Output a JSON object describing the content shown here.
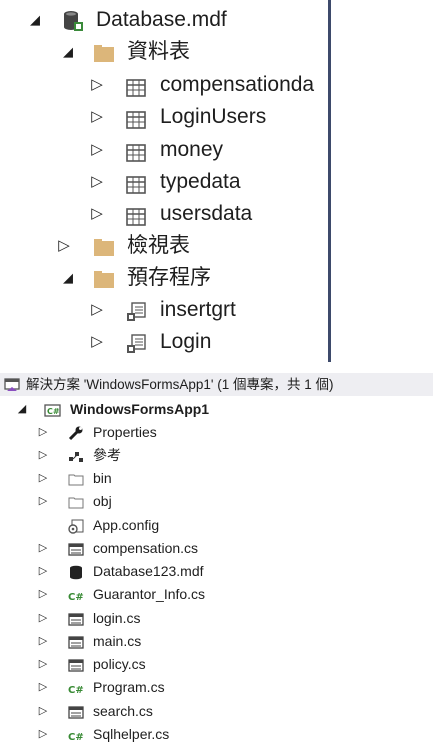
{
  "server_explorer": {
    "database": {
      "label": "Database.mdf"
    },
    "tables_folder": {
      "label": "資料表"
    },
    "tables": [
      {
        "label": "compensationda"
      },
      {
        "label": "LoginUsers"
      },
      {
        "label": "money"
      },
      {
        "label": "typedata"
      },
      {
        "label": "usersdata"
      }
    ],
    "views_folder": {
      "label": "檢視表"
    },
    "procs_folder": {
      "label": "預存程序"
    },
    "procedures": [
      {
        "label": "insertgrt"
      },
      {
        "label": "Login"
      }
    ]
  },
  "solution_explorer": {
    "header": "解決方案 'WindowsFormsApp1' (1 個專案，共 1 個)",
    "project": "WindowsFormsApp1",
    "items": [
      {
        "label": "Properties",
        "icon": "wrench-icon"
      },
      {
        "label": "參考",
        "icon": "references-icon"
      },
      {
        "label": "bin",
        "icon": "folder-outline-icon"
      },
      {
        "label": "obj",
        "icon": "folder-outline-icon"
      },
      {
        "label": "App.config",
        "icon": "config-icon"
      },
      {
        "label": "compensation.cs",
        "icon": "form-icon"
      },
      {
        "label": "Database123.mdf",
        "icon": "database-icon"
      },
      {
        "label": "Guarantor_Info.cs",
        "icon": "csharp-icon"
      },
      {
        "label": "login.cs",
        "icon": "form-icon"
      },
      {
        "label": "main.cs",
        "icon": "form-icon"
      },
      {
        "label": "policy.cs",
        "icon": "form-icon"
      },
      {
        "label": "Program.cs",
        "icon": "csharp-icon"
      },
      {
        "label": "search.cs",
        "icon": "form-icon"
      },
      {
        "label": "Sqlhelper.cs",
        "icon": "csharp-icon"
      }
    ]
  },
  "colors": {
    "folder": "#dcb67a",
    "csharp": "#388a34",
    "table_icon": "#555555",
    "header_bg": "#eeeef2",
    "divider": "#3d4a6b"
  }
}
